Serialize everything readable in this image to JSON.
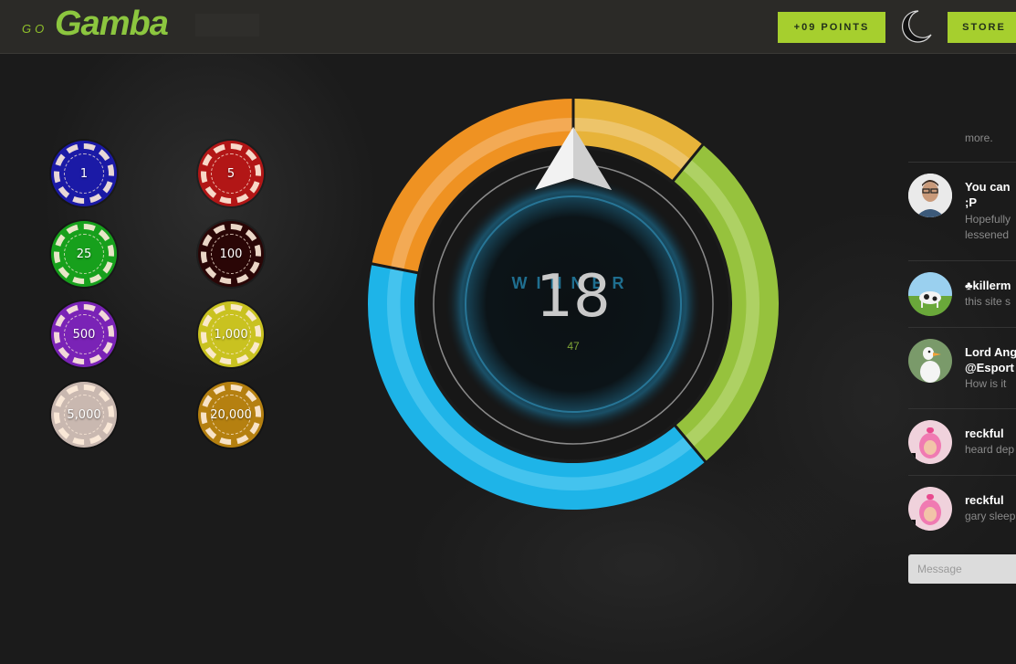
{
  "header": {
    "logo_prefix": "GO",
    "logo_name": "Gamba",
    "points_label": "+09 POINTS",
    "store_label": "STORE"
  },
  "colors": {
    "accent": "#a6cf2e",
    "wheel_orange": "#ef9222",
    "wheel_yellow": "#e7b33a",
    "wheel_green": "#96c23d",
    "wheel_blue": "#1eb4e8"
  },
  "chips": [
    {
      "label": "1",
      "color": "#1b1aa6"
    },
    {
      "label": "5",
      "color": "#b21616"
    },
    {
      "label": "25",
      "color": "#17a01c"
    },
    {
      "label": "100",
      "color": "#2a0606"
    },
    {
      "label": "500",
      "color": "#7a23b6"
    },
    {
      "label": "1,000",
      "color": "#c9c220"
    },
    {
      "label": "5,000",
      "color": "#c9b8b0"
    },
    {
      "label": "20,000",
      "color": "#b58010"
    }
  ],
  "wheel": {
    "winner_label": "WINNER",
    "number": "18",
    "sub_number": "47",
    "segments": [
      "orange",
      "yellow",
      "green",
      "blue"
    ]
  },
  "chat": {
    "more_text": "more.",
    "messages": [
      {
        "name": "You can",
        "name2": ";P",
        "text": "Hopefully",
        "text2": "lessened",
        "avatar": "man-avatar"
      },
      {
        "name": "♣killerm",
        "text": "this site s",
        "avatar": "cow-avatar"
      },
      {
        "name": "Lord Ang",
        "name2": "@Esport",
        "text": "How is it",
        "avatar": "goose-avatar"
      },
      {
        "name": "reckful",
        "text": "heard dep",
        "avatar": "pink-avatar"
      },
      {
        "name": "reckful",
        "text": "gary sleep",
        "avatar": "pink-avatar"
      }
    ],
    "input_placeholder": "Message"
  }
}
